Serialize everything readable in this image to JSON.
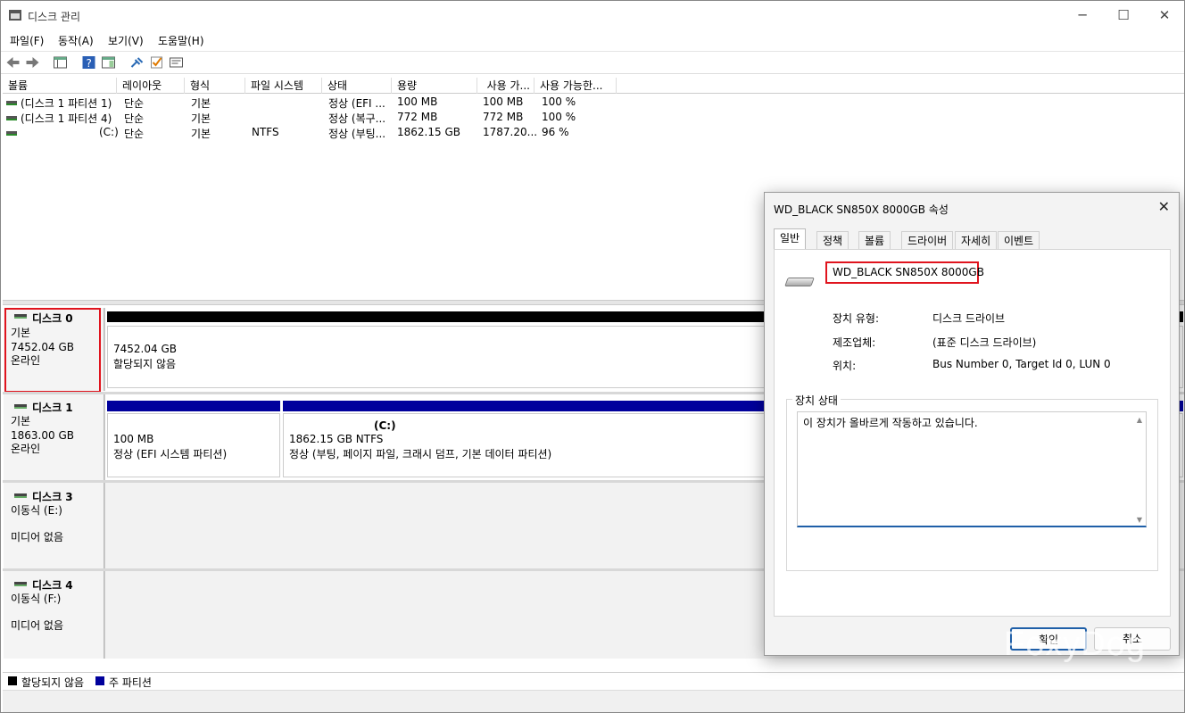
{
  "window": {
    "title": "디스크 관리",
    "controls": {
      "min": "─",
      "max": "☐",
      "close": "✕"
    }
  },
  "menu": [
    "파일(F)",
    "동작(A)",
    "보기(V)",
    "도움말(H)"
  ],
  "toolbar": [
    "back-arrow-icon",
    "forward-arrow-icon",
    "console-tree-icon",
    "help-icon",
    "action-pane-icon",
    "connect-icon",
    "check-icon",
    "properties-icon"
  ],
  "list": {
    "headers": [
      "볼륨",
      "레이아웃",
      "형식",
      "파일 시스템",
      "상태",
      "용량",
      "사용 가...",
      "사용 가능한..."
    ],
    "rows": [
      [
        "(디스크 1 파티션 1)",
        "단순",
        "기본",
        "",
        "정상 (EFI ...",
        "100 MB",
        "100 MB",
        "100 %"
      ],
      [
        "(디스크 1 파티션 4)",
        "단순",
        "기본",
        "",
        "정상 (복구...",
        "772 MB",
        "772 MB",
        "100 %"
      ],
      [
        "(C:)",
        "단순",
        "기본",
        "NTFS",
        "정상 (부팅...",
        "1862.15 GB",
        "1787.20...",
        "96 %"
      ]
    ]
  },
  "disks": [
    {
      "name": "디스크 0",
      "type": "기본",
      "size": "7452.04 GB",
      "status": "온라인",
      "part_size": "7452.04 GB",
      "part_status": "할당되지 않음"
    },
    {
      "name": "디스크 1",
      "type": "기본",
      "size": "1863.00 GB",
      "status": "온라인",
      "p1_size": "100 MB",
      "p1_status": "정상 (EFI 시스템 파티션)",
      "p2_label": "(C:)",
      "p2_size": "1862.15 GB NTFS",
      "p2_status": "정상 (부팅, 페이지 파일, 크래시 덤프, 기본 데이터 파티션)"
    },
    {
      "name": "디스크 3",
      "type": "이동식 (E:)",
      "media": "미디어 없음"
    },
    {
      "name": "디스크 4",
      "type": "이동식 (F:)",
      "media": "미디어 없음"
    }
  ],
  "legend": {
    "unallocated": "할당되지 않음",
    "primary": "주 파티션"
  },
  "dialog": {
    "title": "WD_BLACK SN850X 8000GB 속성",
    "tabs": [
      "일반",
      "정책",
      "볼륨",
      "드라이버",
      "자세히",
      "이벤트"
    ],
    "device_name": "WD_BLACK SN850X 8000GB",
    "props": [
      {
        "label": "장치 유형:",
        "value": "디스크 드라이브"
      },
      {
        "label": "제조업체:",
        "value": "(표준 디스크 드라이브)"
      },
      {
        "label": "위치:",
        "value": "Bus Number 0, Target Id 0, LUN 0"
      }
    ],
    "status_group": "장치 상태",
    "status_text": "이 장치가 올바르게 작동하고 있습니다.",
    "ok": "확인",
    "cancel": "취소"
  },
  "watermark": "FoxyDog",
  "colors": {
    "unallocated": "#000000",
    "primary_partition": "#00009c",
    "highlight": "#e0141e",
    "focus": "#1f5fa8"
  }
}
